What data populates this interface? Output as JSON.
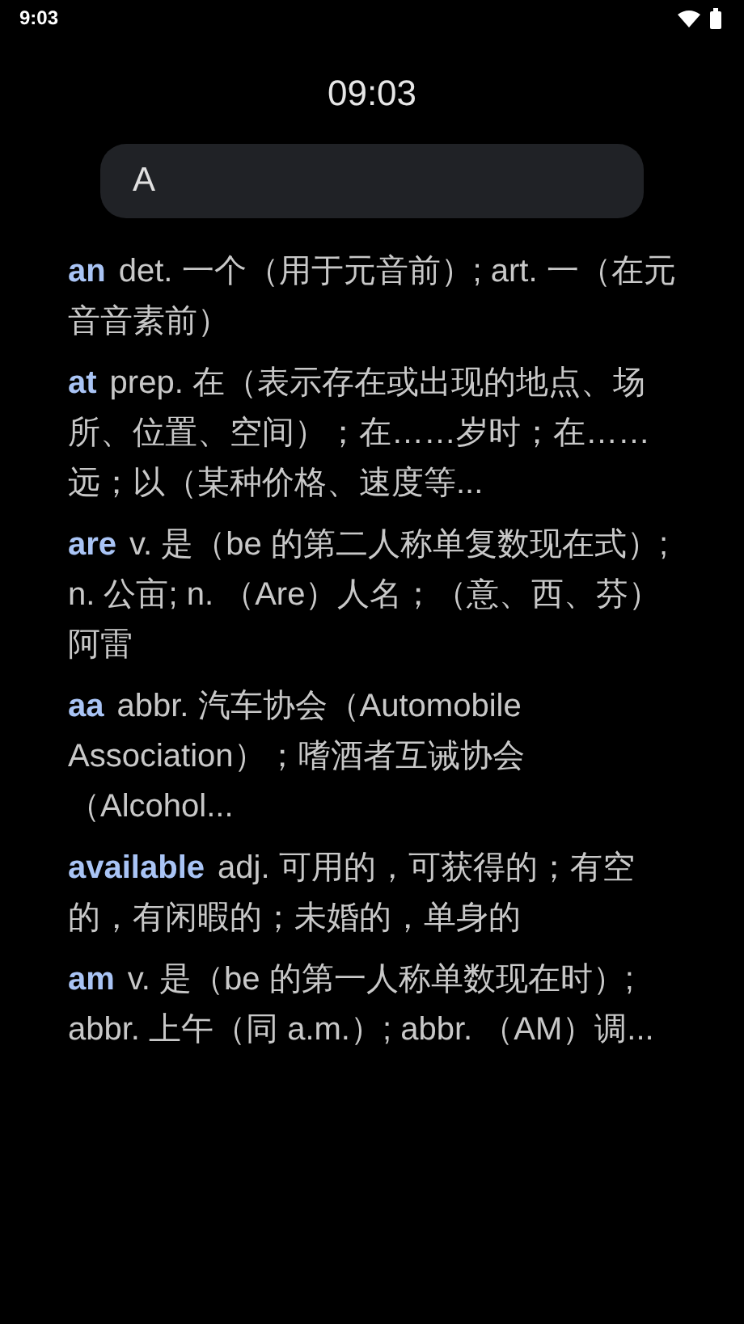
{
  "status_bar": {
    "time": "9:03"
  },
  "clock": "09:03",
  "search": {
    "value": "A"
  },
  "results": [
    {
      "word": "an",
      "definition": "det. 一个（用于元音前）; art. 一（在元音音素前）"
    },
    {
      "word": "at",
      "definition": "prep. 在（表示存在或出现的地点、场所、位置、空间）；在……岁时；在……远；以（某种价格、速度等..."
    },
    {
      "word": "are",
      "definition": "v. 是（be 的第二人称单复数现在式）; n. 公亩; n. （Are）人名；（意、西、芬）阿雷"
    },
    {
      "word": "aa",
      "definition": "abbr. 汽车协会（Automobile Association）；嗜酒者互诫协会（Alcohol..."
    },
    {
      "word": "available",
      "definition": "adj. 可用的，可获得的；有空的，有闲暇的；未婚的，单身的"
    },
    {
      "word": "am",
      "definition": "v. 是（be 的第一人称单数现在时）; abbr. 上午（同 a.m.）; abbr. （AM）调..."
    }
  ]
}
